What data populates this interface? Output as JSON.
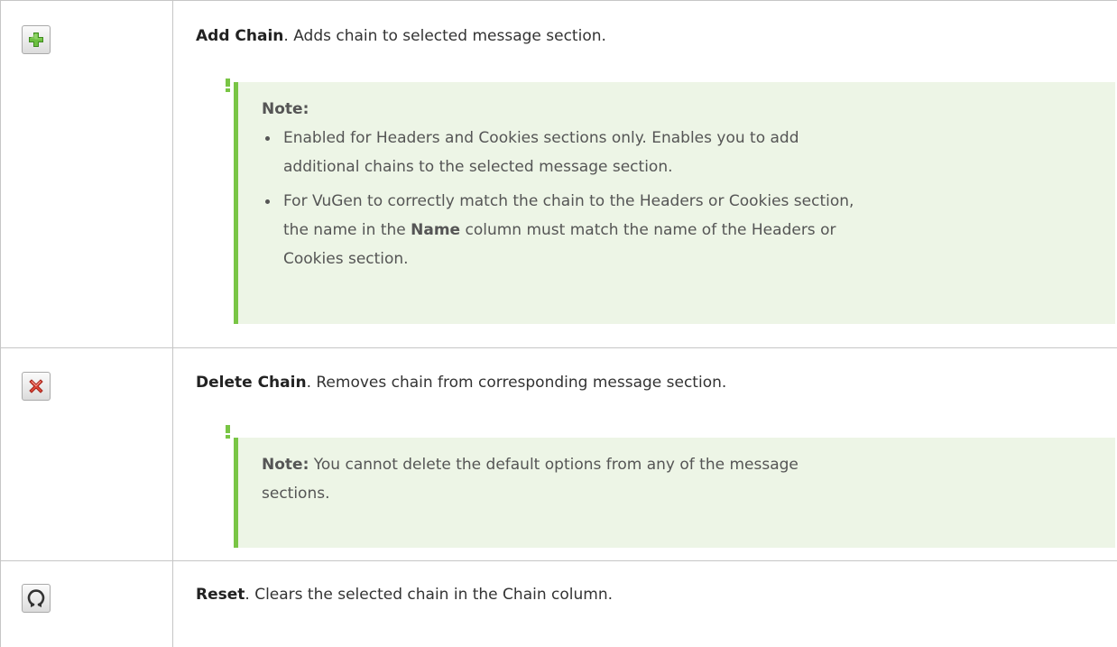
{
  "rows": [
    {
      "icon": "add-chain-icon",
      "title": "Add Chain",
      "description": ". Adds chain to selected message section.",
      "note": {
        "title": "Note:",
        "bullets": [
          {
            "lines": [
              "Enabled for Headers and Cookies sections only. Enables you to add",
              "additional chains to the selected message section."
            ]
          },
          {
            "line1": "For VuGen to correctly match the chain to the Headers or Cookies section,",
            "line2_pre": "the name in the ",
            "line2_bold": "Name",
            "line2_post": " column must match the name of the Headers or",
            "line3": "Cookies section."
          }
        ]
      }
    },
    {
      "icon": "delete-chain-icon",
      "title": "Delete Chain",
      "description": ". Removes chain from corresponding message section.",
      "note": {
        "title": "Note:",
        "text_line1": " You cannot delete the default options from any of the message",
        "text_line2": "sections."
      }
    },
    {
      "icon": "reset-icon",
      "title": "Reset",
      "description": ". Clears the selected chain in the Chain column."
    }
  ],
  "colors": {
    "note_background": "#edf5e6",
    "note_accent": "#79c545",
    "border": "#c6c6c6",
    "add_icon": "#5aa832",
    "delete_icon": "#d9362a",
    "reset_icon": "#333333"
  }
}
